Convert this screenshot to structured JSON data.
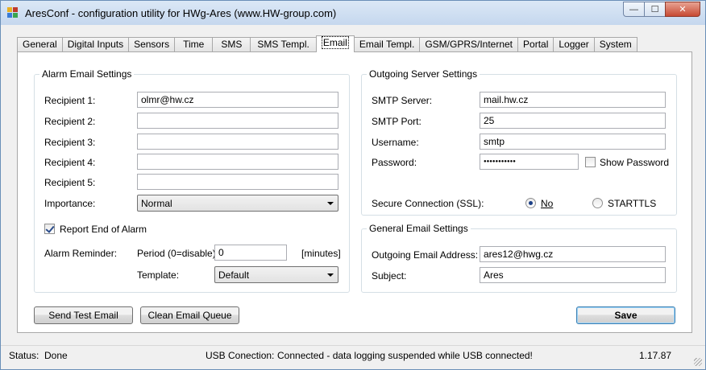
{
  "window": {
    "title": "AresConf - configuration utility for HWg-Ares (www.HW-group.com)",
    "min_glyph": "—",
    "max_glyph": "☐",
    "close_glyph": "✕"
  },
  "tabs": [
    {
      "label": "General"
    },
    {
      "label": "Digital Inputs"
    },
    {
      "label": "Sensors"
    },
    {
      "label": "Time"
    },
    {
      "label": "SMS"
    },
    {
      "label": "SMS Templ."
    },
    {
      "label": "Email"
    },
    {
      "label": "Email Templ."
    },
    {
      "label": "GSM/GPRS/Internet"
    },
    {
      "label": "Portal"
    },
    {
      "label": "Logger"
    },
    {
      "label": "System"
    }
  ],
  "active_tab": "Email",
  "alarm": {
    "group_title": "Alarm Email Settings",
    "recipients": [
      {
        "label": "Recipient 1:",
        "value": "olmr@hw.cz"
      },
      {
        "label": "Recipient 2:",
        "value": ""
      },
      {
        "label": "Recipient 3:",
        "value": ""
      },
      {
        "label": "Recipient 4:",
        "value": ""
      },
      {
        "label": "Recipient 5:",
        "value": ""
      }
    ],
    "importance_label": "Importance:",
    "importance_value": "Normal",
    "report_end_label": "Report End of Alarm",
    "report_end_checked": true,
    "reminder_label": "Alarm Reminder:",
    "period_label": "Period (0=disable):",
    "period_value": "0",
    "period_unit": "[minutes]",
    "template_label": "Template:",
    "template_value": "Default"
  },
  "outgoing": {
    "group_title": "Outgoing Server Settings",
    "smtp_server_label": "SMTP Server:",
    "smtp_server_value": "mail.hw.cz",
    "smtp_port_label": "SMTP Port:",
    "smtp_port_value": "25",
    "username_label": "Username:",
    "username_value": "smtp",
    "password_label": "Password:",
    "password_value": "●●●●●●●●●●●",
    "show_password_label": "Show Password",
    "show_password_checked": false,
    "ssl_label": "Secure Connection (SSL):",
    "ssl_options": [
      {
        "label": "No",
        "selected": true
      },
      {
        "label": "STARTTLS",
        "selected": false
      }
    ]
  },
  "general_email": {
    "group_title": "General Email Settings",
    "address_label": "Outgoing Email Address:",
    "address_value": "ares12@hwg.cz",
    "subject_label": "Subject:",
    "subject_value": "Ares"
  },
  "buttons": {
    "send_test": "Send Test Email",
    "clean_queue": "Clean Email Queue",
    "save": "Save"
  },
  "status": {
    "status_label": "Status:",
    "status_value": "Done",
    "usb_label": "USB Conection:",
    "usb_value": "Connected - data logging suspended while USB connected!",
    "version": "1.17.87"
  },
  "colors": {
    "title_gradient_top": "#dbe8f6",
    "close_button": "#c74a33",
    "radio_dot": "#1b3f86",
    "default_button_border": "#3c7fb1"
  }
}
